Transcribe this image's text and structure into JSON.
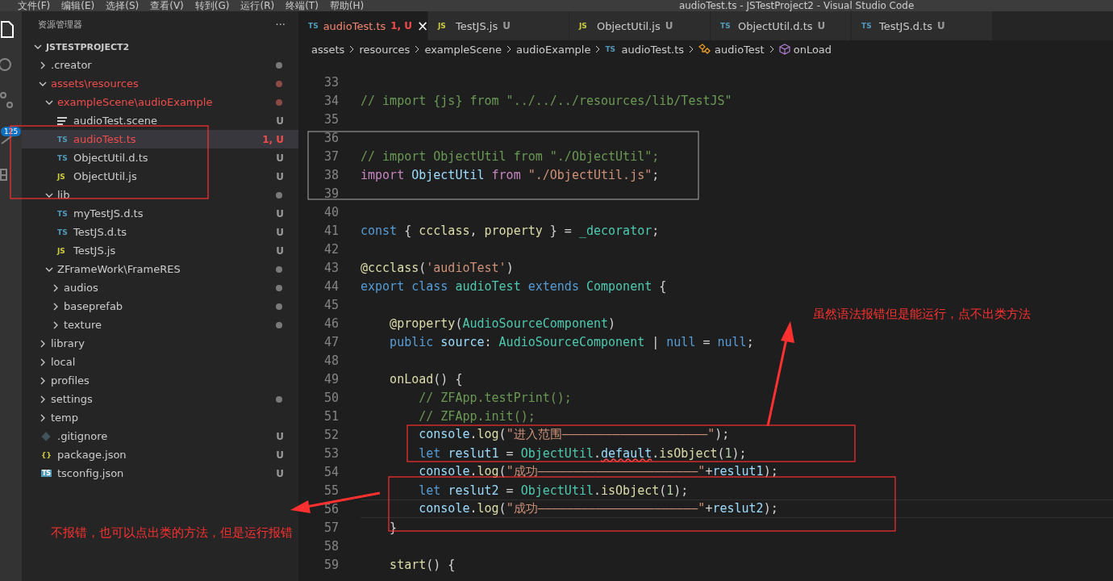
{
  "window": {
    "menu": [
      "文件(F)",
      "编辑(E)",
      "选择(S)",
      "查看(V)",
      "转到(G)",
      "运行(R)",
      "终端(T)",
      "帮助(H)"
    ],
    "title": "audioTest.ts - JSTestProject2 - Visual Studio Code"
  },
  "activity_bar": {
    "badge": "125"
  },
  "sidebar": {
    "title": "资源管理器",
    "more": "···",
    "root": {
      "name": "JSTESTPROJECT2",
      "expanded": true
    },
    "items": [
      {
        "name": ".creator",
        "kind": "folder",
        "expanded": false,
        "dot": true,
        "error": false
      },
      {
        "name": "assets\\resources",
        "kind": "folder",
        "expanded": true,
        "dot": true,
        "error": true,
        "children": [
          {
            "name": "exampleScene\\audioExample",
            "kind": "folder",
            "expanded": true,
            "dot": true,
            "error": true,
            "children": [
              {
                "name": "audioTest.scene",
                "kind": "file",
                "icon": {
                  "kind": "scene"
                },
                "badge": "U",
                "error": false,
                "selected": false
              },
              {
                "name": "audioTest.ts",
                "kind": "file",
                "icon": {
                  "kind": "ts",
                  "text": "TS"
                },
                "badge": "1, U",
                "error": true,
                "selected": true
              },
              {
                "name": "ObjectUtil.d.ts",
                "kind": "file",
                "icon": {
                  "kind": "ts",
                  "text": "TS"
                },
                "badge": "U",
                "error": false,
                "selected": false
              },
              {
                "name": "ObjectUtil.js",
                "kind": "file",
                "icon": {
                  "kind": "js",
                  "text": "JS"
                },
                "badge": "U",
                "error": false,
                "selected": false
              }
            ]
          },
          {
            "name": "lib",
            "kind": "folder",
            "expanded": true,
            "dot": true,
            "error": false,
            "children": [
              {
                "name": "myTestJS.d.ts",
                "kind": "file",
                "icon": {
                  "kind": "ts",
                  "text": "TS"
                },
                "badge": "U",
                "error": false,
                "selected": false
              },
              {
                "name": "TestJS.d.ts",
                "kind": "file",
                "icon": {
                  "kind": "ts",
                  "text": "TS"
                },
                "badge": "U",
                "error": false,
                "selected": false
              },
              {
                "name": "TestJS.js",
                "kind": "file",
                "icon": {
                  "kind": "js",
                  "text": "JS"
                },
                "badge": "U",
                "error": false,
                "selected": false
              }
            ]
          },
          {
            "name": "ZFrameWork\\FrameRES",
            "kind": "folder",
            "expanded": true,
            "dot": true,
            "error": false,
            "children": [
              {
                "name": "audios",
                "kind": "folder",
                "expanded": false,
                "dot": true,
                "error": false
              },
              {
                "name": "baseprefab",
                "kind": "folder",
                "expanded": false,
                "dot": true,
                "error": false
              },
              {
                "name": "texture",
                "kind": "folder",
                "expanded": false,
                "dot": true,
                "error": false
              }
            ]
          }
        ]
      },
      {
        "name": "library",
        "kind": "folder",
        "expanded": false,
        "dot": false,
        "error": false
      },
      {
        "name": "local",
        "kind": "folder",
        "expanded": false,
        "dot": false,
        "error": false
      },
      {
        "name": "profiles",
        "kind": "folder",
        "expanded": false,
        "dot": false,
        "error": false
      },
      {
        "name": "settings",
        "kind": "folder",
        "expanded": false,
        "dot": true,
        "error": false
      },
      {
        "name": "temp",
        "kind": "folder",
        "expanded": false,
        "dot": false,
        "error": false
      },
      {
        "name": ".gitignore",
        "kind": "file",
        "icon": {
          "kind": "git"
        },
        "badge": "U",
        "error": false,
        "selected": false
      },
      {
        "name": "package.json",
        "kind": "file",
        "icon": {
          "kind": "json",
          "text": "{}"
        },
        "badge": "U",
        "error": false,
        "selected": false
      },
      {
        "name": "tsconfig.json",
        "kind": "file",
        "icon": {
          "kind": "tsconfig",
          "text": "TS"
        },
        "badge": "U",
        "error": false,
        "selected": false
      }
    ]
  },
  "tabs": [
    {
      "icon": {
        "kind": "ts",
        "text": "TS"
      },
      "label": "audioTest.ts",
      "badge": "1, U",
      "selected": true,
      "error": true,
      "close": "×"
    },
    {
      "icon": {
        "kind": "js",
        "text": "JS"
      },
      "label": "TestJS.js",
      "badge": "U",
      "selected": false,
      "error": false
    },
    {
      "icon": {
        "kind": "js",
        "text": "JS"
      },
      "label": "ObjectUtil.js",
      "badge": "U",
      "selected": false,
      "error": false
    },
    {
      "icon": {
        "kind": "ts",
        "text": "TS"
      },
      "label": "ObjectUtil.d.ts",
      "badge": "U",
      "selected": false,
      "error": false
    },
    {
      "icon": {
        "kind": "ts",
        "text": "TS"
      },
      "label": "TestJS.d.ts",
      "badge": "U",
      "selected": false,
      "error": false
    }
  ],
  "breadcrumbs": [
    {
      "kind": "folder",
      "label": "assets"
    },
    {
      "kind": "folder",
      "label": "resources"
    },
    {
      "kind": "folder",
      "label": "exampleScene"
    },
    {
      "kind": "folder",
      "label": "audioExample"
    },
    {
      "kind": "file",
      "icon": "TS",
      "label": "audioTest.ts"
    },
    {
      "kind": "class",
      "label": "audioTest"
    },
    {
      "kind": "method",
      "label": "onLoad"
    }
  ],
  "code": [
    {
      "number": "33",
      "current": false
    },
    {
      "number": "34",
      "current": false,
      "tokens": [
        {
          "kind": "comment",
          "text": "// import {js} from \"../../../resources/lib/TestJS\""
        }
      ]
    },
    {
      "number": "35",
      "current": false
    },
    {
      "number": "36",
      "current": false
    },
    {
      "number": "37",
      "current": false,
      "tokens": [
        {
          "kind": "comment",
          "text": "// import ObjectUtil from \"./ObjectUtil\";"
        }
      ]
    },
    {
      "number": "38",
      "current": false,
      "tokens": [
        {
          "kind": "control",
          "text": "import "
        },
        {
          "kind": "variable",
          "text": "ObjectUtil "
        },
        {
          "kind": "control",
          "text": "from "
        },
        {
          "kind": "string",
          "text": "\"./ObjectUtil.js\""
        },
        {
          "kind": "plain",
          "text": ";"
        }
      ]
    },
    {
      "number": "39",
      "current": false
    },
    {
      "number": "40",
      "current": false
    },
    {
      "number": "41",
      "current": false,
      "tokens": [
        {
          "kind": "keyword",
          "text": "const "
        },
        {
          "kind": "plain",
          "text": "{ "
        },
        {
          "kind": "function",
          "text": "ccclass"
        },
        {
          "kind": "plain",
          "text": ", "
        },
        {
          "kind": "function",
          "text": "property"
        },
        {
          "kind": "plain",
          "text": " } = "
        },
        {
          "kind": "type",
          "text": "_decorator"
        },
        {
          "kind": "plain",
          "text": ";"
        }
      ]
    },
    {
      "number": "42",
      "current": false
    },
    {
      "number": "43",
      "current": false,
      "tokens": [
        {
          "kind": "function",
          "text": "@ccclass"
        },
        {
          "kind": "plain",
          "text": "("
        },
        {
          "kind": "string",
          "text": "'audioTest'"
        },
        {
          "kind": "plain",
          "text": ")"
        }
      ]
    },
    {
      "number": "44",
      "current": false,
      "tokens": [
        {
          "kind": "keyword",
          "text": "export class "
        },
        {
          "kind": "type",
          "text": "audioTest "
        },
        {
          "kind": "keyword",
          "text": "extends "
        },
        {
          "kind": "type",
          "text": "Component "
        },
        {
          "kind": "plain",
          "text": "{"
        }
      ]
    },
    {
      "number": "45",
      "current": false
    },
    {
      "number": "46",
      "current": false,
      "tokens": [
        {
          "kind": "function",
          "text": "    @property"
        },
        {
          "kind": "plain",
          "text": "("
        },
        {
          "kind": "type",
          "text": "AudioSourceComponent"
        },
        {
          "kind": "plain",
          "text": ")"
        }
      ]
    },
    {
      "number": "47",
      "current": false,
      "tokens": [
        {
          "kind": "keyword",
          "text": "    public "
        },
        {
          "kind": "variable",
          "text": "source"
        },
        {
          "kind": "plain",
          "text": ": "
        },
        {
          "kind": "type",
          "text": "AudioSourceComponent "
        },
        {
          "kind": "plain",
          "text": "| "
        },
        {
          "kind": "keyword",
          "text": "null "
        },
        {
          "kind": "plain",
          "text": "= "
        },
        {
          "kind": "keyword",
          "text": "null"
        },
        {
          "kind": "plain",
          "text": ";"
        }
      ]
    },
    {
      "number": "48",
      "current": false
    },
    {
      "number": "49",
      "current": false,
      "tokens": [
        {
          "kind": "function",
          "text": "    onLoad"
        },
        {
          "kind": "plain",
          "text": "() {"
        }
      ]
    },
    {
      "number": "50",
      "current": false,
      "tokens": [
        {
          "kind": "comment",
          "text": "        // ZFApp.testPrint();"
        }
      ]
    },
    {
      "number": "51",
      "current": false,
      "tokens": [
        {
          "kind": "comment",
          "text": "        // ZFApp.init();"
        }
      ]
    },
    {
      "number": "52",
      "current": false,
      "tokens": [
        {
          "kind": "variable",
          "text": "        console"
        },
        {
          "kind": "plain",
          "text": "."
        },
        {
          "kind": "function",
          "text": "log"
        },
        {
          "kind": "plain",
          "text": "("
        },
        {
          "kind": "string",
          "text": "\"进入范围————————————————————\""
        },
        {
          "kind": "plain",
          "text": ");"
        }
      ]
    },
    {
      "number": "53",
      "current": false,
      "tokens": [
        {
          "kind": "keyword",
          "text": "        let "
        },
        {
          "kind": "variable",
          "text": "reslut1"
        },
        {
          "kind": "plain",
          "text": " = "
        },
        {
          "kind": "type",
          "text": "ObjectUtil"
        },
        {
          "kind": "plain",
          "text": "."
        },
        {
          "kind": "error",
          "text": "default"
        },
        {
          "kind": "plain",
          "text": "."
        },
        {
          "kind": "function",
          "text": "isObject"
        },
        {
          "kind": "plain",
          "text": "("
        },
        {
          "kind": "number",
          "text": "1"
        },
        {
          "kind": "plain",
          "text": ");"
        }
      ]
    },
    {
      "number": "54",
      "current": false,
      "tokens": [
        {
          "kind": "variable",
          "text": "        console"
        },
        {
          "kind": "plain",
          "text": "."
        },
        {
          "kind": "function",
          "text": "log"
        },
        {
          "kind": "plain",
          "text": "("
        },
        {
          "kind": "string",
          "text": "\"成功——————————————————————\""
        },
        {
          "kind": "plain",
          "text": "+"
        },
        {
          "kind": "variable",
          "text": "reslut1"
        },
        {
          "kind": "plain",
          "text": ");"
        }
      ]
    },
    {
      "number": "55",
      "current": false,
      "tokens": [
        {
          "kind": "keyword",
          "text": "        let "
        },
        {
          "kind": "variable",
          "text": "reslut2"
        },
        {
          "kind": "plain",
          "text": " = "
        },
        {
          "kind": "type",
          "text": "ObjectUtil"
        },
        {
          "kind": "plain",
          "text": "."
        },
        {
          "kind": "function",
          "text": "isObject"
        },
        {
          "kind": "plain",
          "text": "("
        },
        {
          "kind": "number",
          "text": "1"
        },
        {
          "kind": "plain",
          "text": ");"
        }
      ]
    },
    {
      "number": "56",
      "current": true,
      "tokens": [
        {
          "kind": "variable",
          "text": "        console"
        },
        {
          "kind": "plain",
          "text": "."
        },
        {
          "kind": "function",
          "text": "log"
        },
        {
          "kind": "plain",
          "text": "("
        },
        {
          "kind": "string",
          "text": "\"成功——————————————————————\""
        },
        {
          "kind": "plain",
          "text": "+"
        },
        {
          "kind": "variable",
          "text": "reslut2"
        },
        {
          "kind": "plain",
          "text": ");"
        }
      ]
    },
    {
      "number": "57",
      "current": false,
      "tokens": [
        {
          "kind": "plain",
          "text": "    }"
        }
      ]
    },
    {
      "number": "58",
      "current": false
    },
    {
      "number": "59",
      "current": false,
      "tokens": [
        {
          "kind": "function",
          "text": "    start"
        },
        {
          "kind": "plain",
          "text": "() {"
        }
      ]
    }
  ],
  "annotations": [
    {
      "kind": "note",
      "text": "虽然语法报错但是能运行，点不出类方法"
    },
    {
      "kind": "note",
      "text": "不报错，也可以点出类的方法，但是运行报错"
    }
  ]
}
